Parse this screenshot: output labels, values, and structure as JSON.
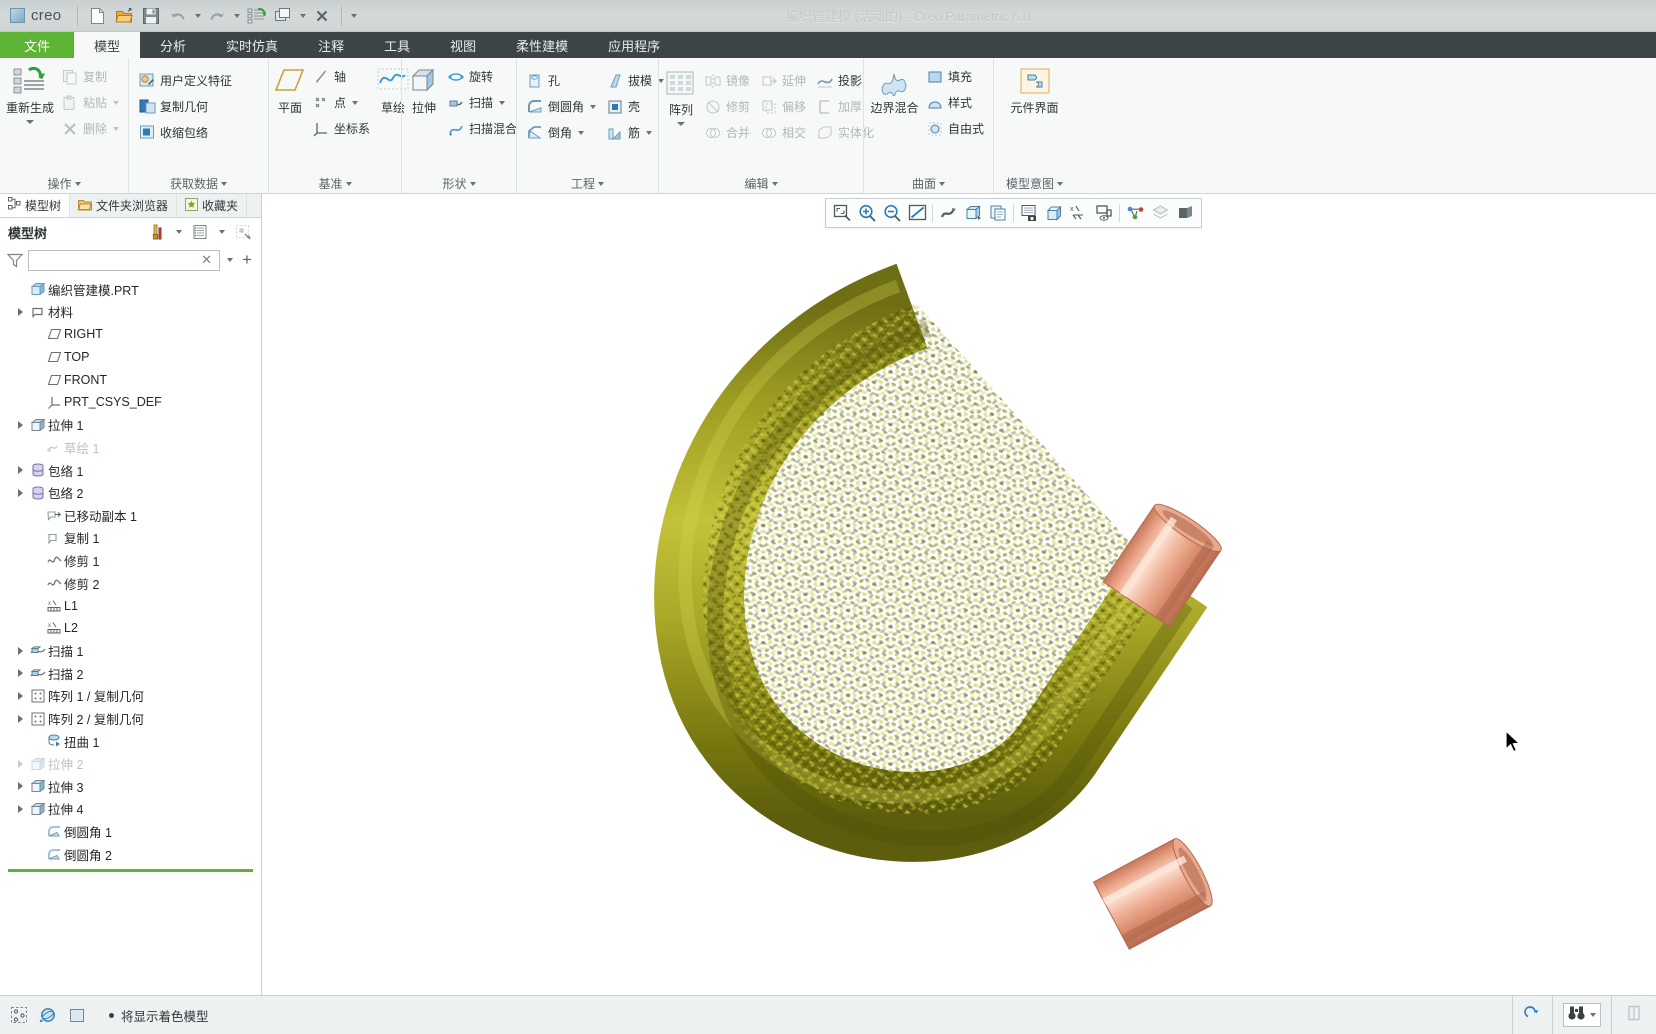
{
  "window": {
    "title": "编织管建模 (活动的) - Creo Parametric 6.0",
    "app_name": "creo"
  },
  "quick_access": {
    "items": [
      {
        "name": "new-file-icon",
        "label": "新建"
      },
      {
        "name": "open-file-icon",
        "label": "打开"
      },
      {
        "name": "save-icon",
        "label": "保存"
      },
      {
        "name": "undo-icon",
        "label": "撤消"
      },
      {
        "name": "redo-icon",
        "label": "重做"
      },
      {
        "name": "regenerate-icon",
        "label": "重新生成"
      },
      {
        "name": "window-icon",
        "label": "窗口"
      },
      {
        "name": "close-window-icon",
        "label": "关闭"
      }
    ]
  },
  "ribbon": {
    "tabs": [
      {
        "label": "文件",
        "type": "file"
      },
      {
        "label": "模型",
        "type": "active"
      },
      {
        "label": "分析",
        "type": "normal"
      },
      {
        "label": "实时仿真",
        "type": "normal"
      },
      {
        "label": "注释",
        "type": "normal"
      },
      {
        "label": "工具",
        "type": "normal"
      },
      {
        "label": "视图",
        "type": "normal"
      },
      {
        "label": "柔性建模",
        "type": "normal"
      },
      {
        "label": "应用程序",
        "type": "normal"
      }
    ],
    "groups": [
      {
        "title": "操作",
        "big": {
          "label": "重新生成",
          "icon": "regenerate-icon",
          "has_menu": true
        },
        "items": [
          {
            "label": "复制",
            "icon": "copy-icon",
            "disabled": true,
            "menu": false
          },
          {
            "label": "粘贴",
            "icon": "paste-icon",
            "disabled": true,
            "menu": true
          },
          {
            "label": "删除",
            "icon": "delete-icon",
            "disabled": true,
            "menu": true
          }
        ]
      },
      {
        "title": "获取数据",
        "items": [
          {
            "label": "用户定义特征",
            "icon": "udf-icon",
            "disabled": false,
            "menu": false
          },
          {
            "label": "复制几何",
            "icon": "copy-geometry-icon",
            "disabled": false,
            "menu": false
          },
          {
            "label": "收缩包络",
            "icon": "shrinkwrap-icon",
            "disabled": false,
            "menu": false
          }
        ]
      },
      {
        "title": "基准",
        "big": {
          "label": "平面",
          "icon": "datum-plane-icon",
          "has_menu": false
        },
        "items": [
          {
            "label": "轴",
            "icon": "datum-axis-icon",
            "disabled": false,
            "menu": false
          },
          {
            "label": "点",
            "icon": "datum-point-icon",
            "disabled": false,
            "menu": true
          },
          {
            "label": "坐标系",
            "icon": "coordinate-system-icon",
            "disabled": false,
            "menu": false
          }
        ],
        "extra_big": {
          "label": "草绘",
          "icon": "sketch-icon"
        }
      },
      {
        "title": "形状",
        "big": {
          "label": "拉伸",
          "icon": "extrude-icon",
          "has_menu": false
        },
        "items": [
          {
            "label": "旋转",
            "icon": "revolve-icon",
            "disabled": false,
            "menu": false
          },
          {
            "label": "扫描",
            "icon": "sweep-icon",
            "disabled": false,
            "menu": true
          },
          {
            "label": "扫描混合",
            "icon": "swept-blend-icon",
            "disabled": false,
            "menu": false
          }
        ]
      },
      {
        "title": "工程",
        "items_col1": [
          {
            "label": "孔",
            "icon": "hole-icon",
            "disabled": false,
            "menu": false
          },
          {
            "label": "倒圆角",
            "icon": "round-icon",
            "disabled": false,
            "menu": true
          },
          {
            "label": "倒角",
            "icon": "chamfer-icon",
            "disabled": false,
            "menu": true
          }
        ],
        "items_col2": [
          {
            "label": "拔模",
            "icon": "draft-icon",
            "disabled": false,
            "menu": true
          },
          {
            "label": "壳",
            "icon": "shell-icon",
            "disabled": false,
            "menu": false
          },
          {
            "label": "筋",
            "icon": "rib-icon",
            "disabled": false,
            "menu": true
          }
        ]
      },
      {
        "title": "编辑",
        "big": {
          "label": "阵列",
          "icon": "pattern-icon",
          "has_menu": true
        },
        "items_col1": [
          {
            "label": "镜像",
            "icon": "mirror-icon",
            "disabled": true,
            "menu": false
          },
          {
            "label": "修剪",
            "icon": "trim-icon",
            "disabled": true,
            "menu": false
          },
          {
            "label": "合并",
            "icon": "merge-icon",
            "disabled": true,
            "menu": false
          }
        ],
        "items_col2": [
          {
            "label": "延伸",
            "icon": "extend-icon",
            "disabled": true,
            "menu": false
          },
          {
            "label": "偏移",
            "icon": "offset-icon",
            "disabled": true,
            "menu": false
          },
          {
            "label": "相交",
            "icon": "intersect-icon",
            "disabled": true,
            "menu": false
          }
        ],
        "items_col3": [
          {
            "label": "投影",
            "icon": "project-icon",
            "disabled": false,
            "menu": false
          },
          {
            "label": "加厚",
            "icon": "thicken-icon",
            "disabled": true,
            "menu": false
          },
          {
            "label": "实体化",
            "icon": "solidify-icon",
            "disabled": true,
            "menu": false
          }
        ]
      },
      {
        "title": "曲面",
        "big": {
          "label": "边界混合",
          "icon": "boundary-blend-icon",
          "has_menu": false
        },
        "items": [
          {
            "label": "填充",
            "icon": "fill-icon",
            "disabled": false,
            "menu": false
          },
          {
            "label": "样式",
            "icon": "style-icon",
            "disabled": false,
            "menu": false
          },
          {
            "label": "自由式",
            "icon": "freestyle-icon",
            "disabled": false,
            "menu": false
          }
        ]
      },
      {
        "title": "模型意图",
        "big": {
          "label": "元件界面",
          "icon": "component-interface-icon",
          "has_menu": false
        },
        "items": []
      }
    ]
  },
  "sidebar": {
    "nav_tabs": [
      {
        "label": "模型树",
        "icon": "model-tree-icon",
        "active": true
      },
      {
        "label": "文件夹浏览器",
        "icon": "folder-browser-icon",
        "active": false
      },
      {
        "label": "收藏夹",
        "icon": "favorites-icon",
        "active": false
      }
    ],
    "panel_title": "模型树",
    "toolbar": [
      {
        "name": "tree-filters-icon",
        "label": "树过滤器"
      },
      {
        "name": "tree-columns-icon",
        "label": "树列"
      },
      {
        "name": "tree-settings-icon",
        "label": "设置"
      }
    ],
    "filter": {
      "value": "",
      "placeholder": ""
    },
    "tree": [
      {
        "label": "编织管建模.PRT",
        "icon": "part-icon",
        "indent": 0,
        "expandable": false,
        "dim": false
      },
      {
        "label": "材料",
        "icon": "material-icon",
        "indent": 1,
        "expandable": true,
        "dim": false
      },
      {
        "label": "RIGHT",
        "icon": "datum-plane-icon",
        "indent": 1,
        "expandable": false,
        "dim": false
      },
      {
        "label": "TOP",
        "icon": "datum-plane-icon",
        "indent": 1,
        "expandable": false,
        "dim": false
      },
      {
        "label": "FRONT",
        "icon": "datum-plane-icon",
        "indent": 1,
        "expandable": false,
        "dim": false
      },
      {
        "label": "PRT_CSYS_DEF",
        "icon": "coordinate-system-icon",
        "indent": 1,
        "expandable": false,
        "dim": false
      },
      {
        "label": "拉伸 1",
        "icon": "extrude-icon",
        "indent": 1,
        "expandable": true,
        "dim": false
      },
      {
        "label": "草绘 1",
        "icon": "sketch-icon",
        "indent": 1,
        "expandable": false,
        "dim": true
      },
      {
        "label": "包络 1",
        "icon": "envelope-icon",
        "indent": 1,
        "expandable": true,
        "dim": false
      },
      {
        "label": "包络 2",
        "icon": "envelope-icon",
        "indent": 1,
        "expandable": true,
        "dim": false
      },
      {
        "label": "已移动副本 1",
        "icon": "moved-copy-icon",
        "indent": 1,
        "expandable": false,
        "dim": false
      },
      {
        "label": "复制 1",
        "icon": "copy-feature-icon",
        "indent": 1,
        "expandable": false,
        "dim": false
      },
      {
        "label": "修剪 1",
        "icon": "trim-curve-icon",
        "indent": 1,
        "expandable": false,
        "dim": false
      },
      {
        "label": "修剪 2",
        "icon": "trim-curve-icon",
        "indent": 1,
        "expandable": false,
        "dim": false
      },
      {
        "label": "L1",
        "icon": "measure-icon",
        "indent": 1,
        "expandable": false,
        "dim": false
      },
      {
        "label": "L2",
        "icon": "measure-icon",
        "indent": 1,
        "expandable": false,
        "dim": false
      },
      {
        "label": "扫描 1",
        "icon": "sweep-icon",
        "indent": 1,
        "expandable": true,
        "dim": false
      },
      {
        "label": "扫描 2",
        "icon": "sweep-icon",
        "indent": 1,
        "expandable": true,
        "dim": false
      },
      {
        "label": "阵列 1 / 复制几何",
        "icon": "pattern-icon",
        "indent": 1,
        "expandable": true,
        "dim": false
      },
      {
        "label": "阵列 2 / 复制几何",
        "icon": "pattern-icon",
        "indent": 1,
        "expandable": true,
        "dim": false
      },
      {
        "label": "扭曲 1",
        "icon": "warp-icon",
        "indent": 1,
        "expandable": false,
        "dim": false
      },
      {
        "label": "拉伸 2",
        "icon": "extrude-icon",
        "indent": 1,
        "expandable": true,
        "dim": true
      },
      {
        "label": "拉伸 3",
        "icon": "extrude-icon",
        "indent": 1,
        "expandable": true,
        "dim": false
      },
      {
        "label": "拉伸 4",
        "icon": "extrude-icon",
        "indent": 1,
        "expandable": true,
        "dim": false
      },
      {
        "label": "倒圆角 1",
        "icon": "round-icon",
        "indent": 1,
        "expandable": false,
        "dim": false
      },
      {
        "label": "倒圆角 2",
        "icon": "round-icon",
        "indent": 1,
        "expandable": false,
        "dim": false
      }
    ]
  },
  "graphics_toolbar": {
    "buttons": [
      {
        "name": "zoom-to-fit-icon",
        "label": "重新调整"
      },
      {
        "name": "zoom-in-icon",
        "label": "放大"
      },
      {
        "name": "zoom-out-icon",
        "label": "缩小"
      },
      {
        "name": "refit-icon",
        "label": "重新调整对象"
      },
      {
        "name": "spin-center-icon",
        "label": "旋转中心"
      },
      {
        "name": "display-style-icon",
        "label": "显示样式"
      },
      {
        "name": "saved-orientations-icon",
        "label": "已保存方向"
      },
      {
        "name": "view-manager-icon",
        "label": "视图管理器"
      },
      {
        "name": "appearance-icon",
        "label": "外观"
      },
      {
        "name": "datum-display-icon",
        "label": "基准显示过滤器"
      },
      {
        "name": "annotation-display-icon",
        "label": "注释显示"
      },
      {
        "name": "spin-icon",
        "label": "旋转"
      },
      {
        "name": "layer-icon",
        "label": "层"
      },
      {
        "name": "section-icon",
        "label": "截面"
      }
    ]
  },
  "model": {
    "description": "编织管 (braided hose) U-bend model",
    "braid_color": "#9a9a22",
    "braid_highlight": "#c8c63a",
    "braid_shadow": "#6f6f16",
    "fitting_color": "#e8a084",
    "fitting_highlight": "#f8d4c4",
    "fitting_shadow": "#c07a5c"
  },
  "statusbar": {
    "left_buttons": [
      {
        "name": "selection-filter-icon",
        "label": "选择过滤器"
      },
      {
        "name": "spin-globe-icon",
        "label": "旋转模式"
      },
      {
        "name": "display-toggle-icon",
        "label": "显示切换"
      }
    ],
    "message": "将显示着色模型",
    "right_buttons": [
      {
        "name": "regenerate-status-icon",
        "label": "重新生成状态"
      },
      {
        "name": "search-binoculars-icon",
        "label": "查找"
      },
      {
        "name": "panel-toggle-icon",
        "label": "面板显示"
      }
    ]
  }
}
